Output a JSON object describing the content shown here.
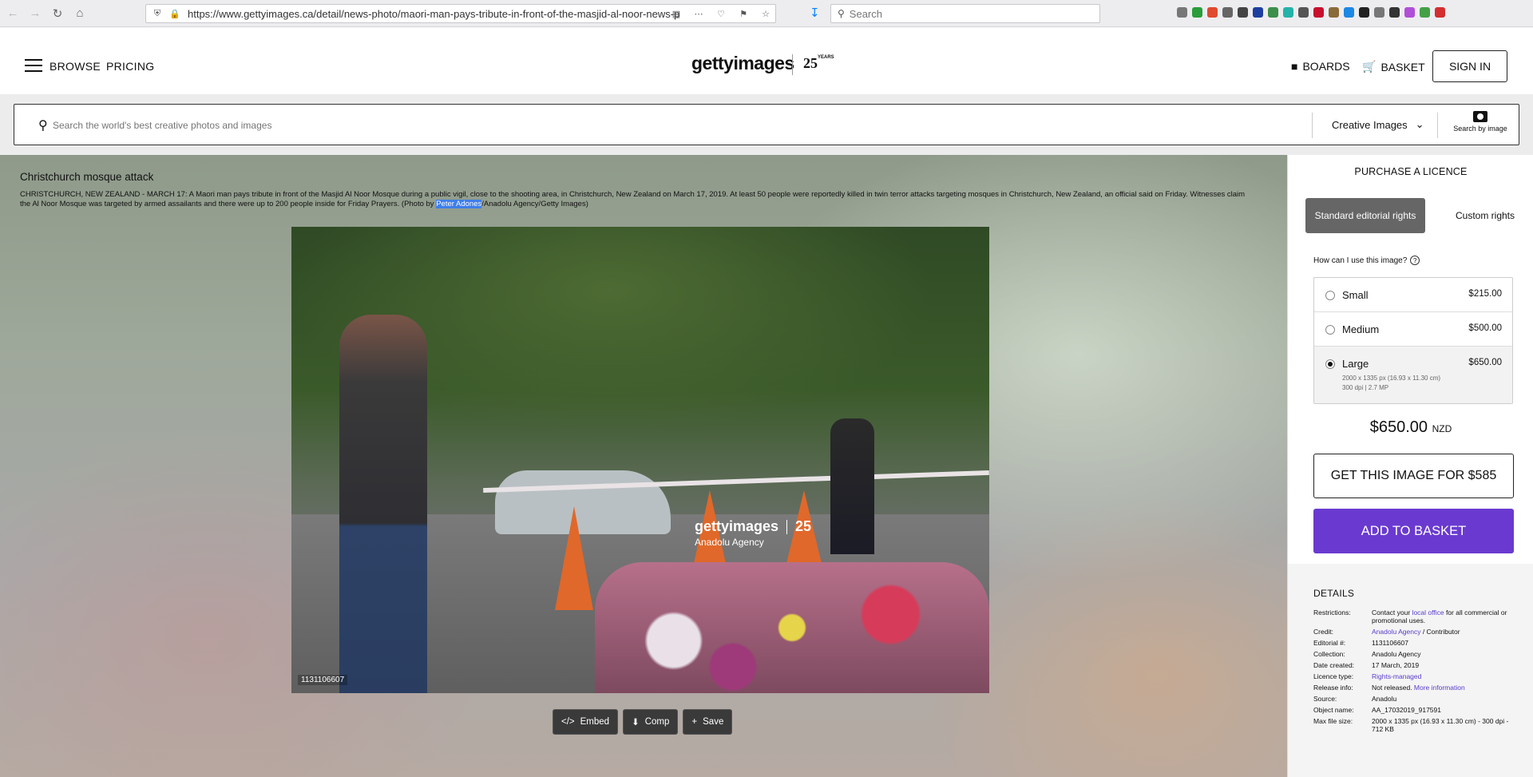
{
  "browser": {
    "url": "https://www.gettyimages.ca/detail/news-photo/maori-man-pays-tribute-in-front-of-the-masjid-al-noor-news-p",
    "search_placeholder": "Search"
  },
  "header": {
    "browse": "BROWSE",
    "pricing": "PRICING",
    "logo": "gettyimages",
    "logo_anniversary": "25",
    "logo_years": "YEARS",
    "boards": "BOARDS",
    "basket": "BASKET",
    "sign_in": "SIGN IN"
  },
  "search": {
    "placeholder": "Search the world's best creative photos and images",
    "category": "Creative Images",
    "by_image": "Search by image"
  },
  "image": {
    "title": "Christchurch mosque attack",
    "caption_before": "CHRISTCHURCH, NEW ZEALAND - MARCH 17: A Maori man pays tribute in front of the Masjid Al Noor Mosque during a public vigil, close to the shooting area, in Christchurch, New Zealand on March 17, 2019. At least 50 people were reportedly killed in twin terror attacks targeting mosques in Christchurch, New Zealand, an official said on Friday. Witnesses claim the Al Noor Mosque was targeted by armed assailants and there were up to 200 people inside for Friday Prayers. (Photo by ",
    "caption_highlight": "Peter Adones",
    "caption_after": "/Anadolu Agency/Getty Images)",
    "watermark_logo": "gettyimages",
    "watermark_25": "25",
    "watermark_agency": "Anadolu Agency",
    "id": "1131106607"
  },
  "actions": {
    "embed": "Embed",
    "comp": "Comp",
    "save": "Save"
  },
  "panel": {
    "heading": "PURCHASE A LICENCE",
    "rights_standard": "Standard editorial rights",
    "rights_custom": "Custom rights",
    "how_use": "How can I use this image?",
    "sizes": [
      {
        "name": "Small",
        "price": "$215.00",
        "selected": false
      },
      {
        "name": "Medium",
        "price": "$500.00",
        "selected": false
      },
      {
        "name": "Large",
        "price": "$650.00",
        "selected": true,
        "detail1": "2000 x 1335 px (16.93 x 11.30 cm)",
        "detail2": "300 dpi | 2.7 MP"
      }
    ],
    "total": "$650.00",
    "currency": "NZD",
    "get_button": "GET THIS IMAGE FOR $585",
    "basket_button": "ADD TO BASKET",
    "details_title": "DETAILS",
    "details": {
      "restrictions_label": "Restrictions:",
      "restrictions_1": "Contact your ",
      "restrictions_link": "local office",
      "restrictions_2": " for all commercial or promotional uses.",
      "credit_label": "Credit:",
      "credit_link": "Anadolu Agency",
      "credit_rest": " / Contributor",
      "editorial_label": "Editorial #:",
      "editorial": "1131106607",
      "collection_label": "Collection:",
      "collection": "Anadolu Agency",
      "date_label": "Date created:",
      "date": "17 March, 2019",
      "licence_label": "Licence type:",
      "licence": "Rights-managed",
      "release_label": "Release info:",
      "release": "Not released. ",
      "release_link": "More information",
      "source_label": "Source:",
      "source": "Anadolu",
      "object_label": "Object name:",
      "object": "AA_17032019_917591",
      "maxsize_label": "Max file size:",
      "maxsize": "2000 x 1335 px (16.93 x 11.30 cm) - 300 dpi - 712 KB"
    }
  },
  "colors": {
    "accent_purple": "#6a3ad0",
    "link": "#5a3ccc",
    "highlight": "#3f7ee8"
  }
}
